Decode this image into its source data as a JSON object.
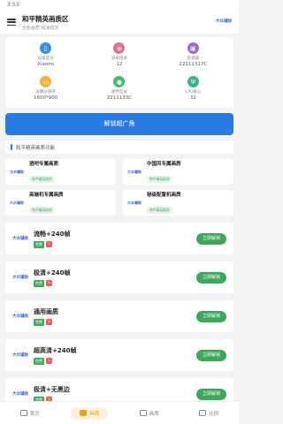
{
  "status": {
    "time": "3:53"
  },
  "header": {
    "title": "和平精英画质区",
    "subtitle": "全新画质 极速稳定",
    "logo": "大众辅助"
  },
  "info": [
    {
      "label": "设备型号",
      "value": "Xiaomi",
      "color": "#3a8ee8",
      "icon": "phone-icon",
      "glyph": "▯"
    },
    {
      "label": "安卓版本",
      "value": "12",
      "color": "#f26d8a",
      "icon": "android-icon",
      "glyph": "◆"
    },
    {
      "label": "处理器",
      "value": "22111317C",
      "color": "#9a6be0",
      "icon": "chip-icon",
      "glyph": "▣"
    },
    {
      "label": "屏幕分辨率",
      "value": "1600*900",
      "color": "#f3b13a",
      "icon": "screen-icon",
      "glyph": "▭"
    },
    {
      "label": "硬件型号",
      "value": "2211133C",
      "color": "#3bbf6a",
      "icon": "hardware-icon",
      "glyph": "●"
    },
    {
      "label": "CPU核心",
      "value": "32",
      "color": "#38b38a",
      "icon": "cpu-icon",
      "glyph": "Ψ"
    }
  ],
  "unlock_label": "解锁超广角",
  "section_title": "和平精英画质功能",
  "features": [
    {
      "title": "酒吧专属画质",
      "tag": "和平精英画质"
    },
    {
      "title": "中国风专属画质",
      "tag": "和平精英画质"
    },
    {
      "title": "高端机专属画质",
      "tag": "和平精英画质"
    },
    {
      "title": "秘级配置机画质",
      "tag": "和平精英画质"
    }
  ],
  "list": [
    {
      "title": "流畅+240帧",
      "free": "免费",
      "button": "立即解锁"
    },
    {
      "title": "极清+240帧",
      "free": "免费",
      "button": "立即解锁"
    },
    {
      "title": "通用画质",
      "free": "免费",
      "button": "立即解锁"
    },
    {
      "title": "超高清+240帧",
      "free": "免费",
      "button": "立即解锁"
    },
    {
      "title": "极清+无黑边",
      "free": "免费",
      "button": "立即解锁"
    }
  ],
  "nav": [
    {
      "label": "首页",
      "active": false
    },
    {
      "label": "画质",
      "active": true
    },
    {
      "label": "画质",
      "active": false
    },
    {
      "label": "比例",
      "active": false
    }
  ],
  "small_logo": "大众辅助"
}
